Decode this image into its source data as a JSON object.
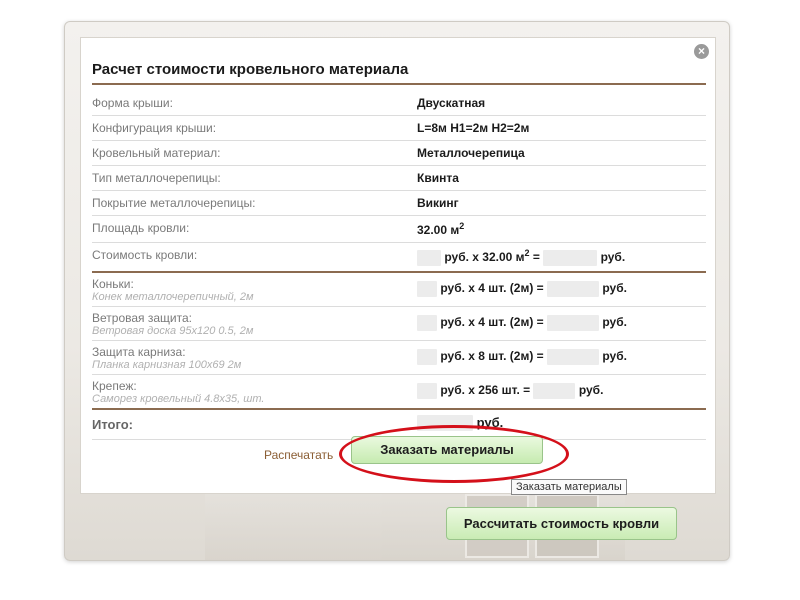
{
  "modal": {
    "title": "Расчет стоимости кровельного материала",
    "close_symbol": "×",
    "rows": [
      {
        "label": "Форма крыши:",
        "value": "Двускатная"
      },
      {
        "label": "Конфигурация крыши:",
        "value": "L=8м H1=2м H2=2м"
      },
      {
        "label": "Кровельный материал:",
        "value": "Металлочерепица"
      },
      {
        "label": "Тип металлочерепицы:",
        "value": "Квинта"
      },
      {
        "label": "Покрытие металлочерепицы:",
        "value": "Викинг"
      },
      {
        "label": "Площадь кровли:",
        "value": "32.00 м",
        "sup": "2"
      },
      {
        "label": "Стоимость кровли:",
        "mid": "руб. x 32.00 м",
        "sup": "2",
        "eq": " =",
        "unit": "руб."
      }
    ],
    "items": [
      {
        "title": "Коньки:",
        "desc": "Конек металлочерепичный, 2м",
        "mid": "руб. x 4 шт. (2м) =",
        "unit": "руб."
      },
      {
        "title": "Ветровая защита:",
        "desc": "Ветровая доска 95х120 0.5, 2м",
        "mid": "руб. x 4 шт. (2м) =",
        "unit": "руб."
      },
      {
        "title": "Защита карниза:",
        "desc": "Планка карнизная 100х69 2м",
        "mid": "руб. x 8 шт. (2м) =",
        "unit": "руб."
      },
      {
        "title": "Крепеж:",
        "desc": "Саморез кровельный 4.8х35, шт.",
        "mid": "руб. x 256 шт. =",
        "unit": "руб."
      }
    ],
    "total": {
      "label": "Итого:",
      "unit": "руб."
    },
    "print_label": "Распечатать",
    "order_button": "Заказать материалы",
    "tooltip": "Заказать материалы"
  },
  "calc_button": "Рассчитать стоимость кровли"
}
